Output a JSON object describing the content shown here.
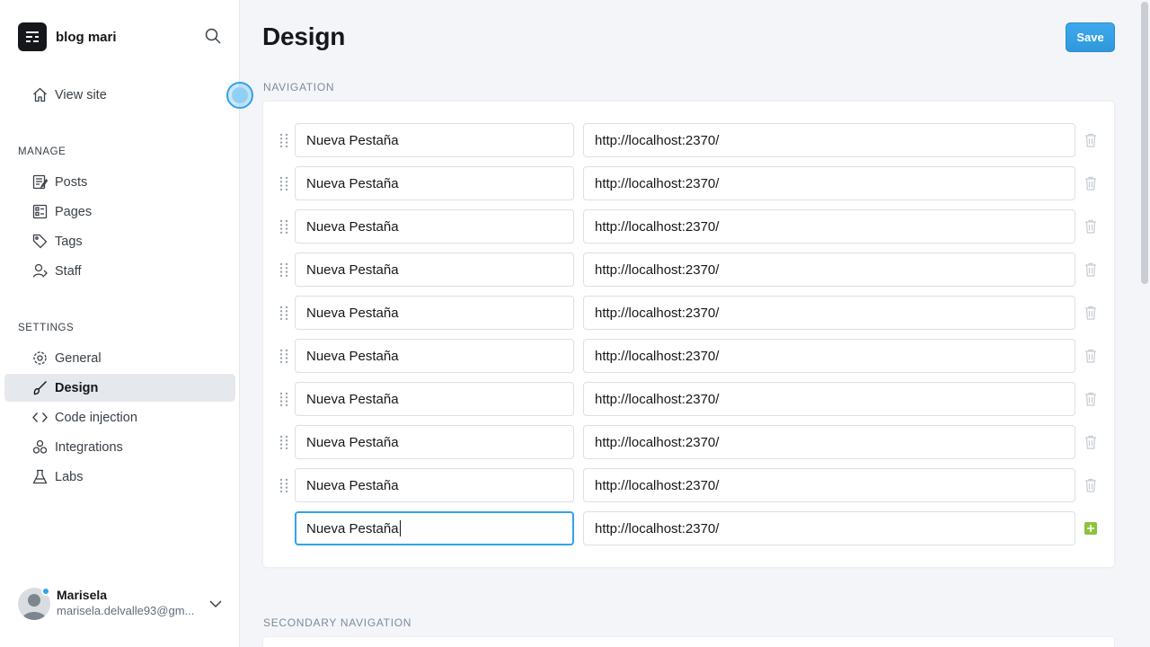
{
  "sidebar": {
    "site_name": "blog mari",
    "view_site": "View site",
    "manage_label": "MANAGE",
    "settings_label": "SETTINGS",
    "manage_items": [
      {
        "label": "Posts",
        "icon": "posts-icon"
      },
      {
        "label": "Pages",
        "icon": "pages-icon"
      },
      {
        "label": "Tags",
        "icon": "tag-icon"
      },
      {
        "label": "Staff",
        "icon": "staff-icon"
      }
    ],
    "settings_items": [
      {
        "label": "General",
        "icon": "gear-icon"
      },
      {
        "label": "Design",
        "icon": "brush-icon",
        "active": true
      },
      {
        "label": "Code injection",
        "icon": "code-icon"
      },
      {
        "label": "Integrations",
        "icon": "integrations-icon"
      },
      {
        "label": "Labs",
        "icon": "flask-icon"
      }
    ],
    "user": {
      "name": "Marisela",
      "email": "marisela.delvalle93@gm..."
    }
  },
  "main": {
    "title": "Design",
    "save_label": "Save",
    "navigation_label": "NAVIGATION",
    "secondary_navigation_label": "SECONDARY NAVIGATION",
    "navigation_items": [
      {
        "label": "Nueva Pestaña",
        "url": "http://localhost:2370/"
      },
      {
        "label": "Nueva Pestaña",
        "url": "http://localhost:2370/"
      },
      {
        "label": "Nueva Pestaña",
        "url": "http://localhost:2370/"
      },
      {
        "label": "Nueva Pestaña",
        "url": "http://localhost:2370/"
      },
      {
        "label": "Nueva Pestaña",
        "url": "http://localhost:2370/"
      },
      {
        "label": "Nueva Pestaña",
        "url": "http://localhost:2370/"
      },
      {
        "label": "Nueva Pestaña",
        "url": "http://localhost:2370/"
      },
      {
        "label": "Nueva Pestaña",
        "url": "http://localhost:2370/"
      },
      {
        "label": "Nueva Pestaña",
        "url": "http://localhost:2370/"
      }
    ],
    "new_item": {
      "label": "Nueva Pestaña",
      "url": "http://localhost:2370/"
    }
  },
  "colors": {
    "accent": "#30a3ec",
    "add_green": "#8dc23d",
    "active_bg": "#e5e8ed"
  }
}
